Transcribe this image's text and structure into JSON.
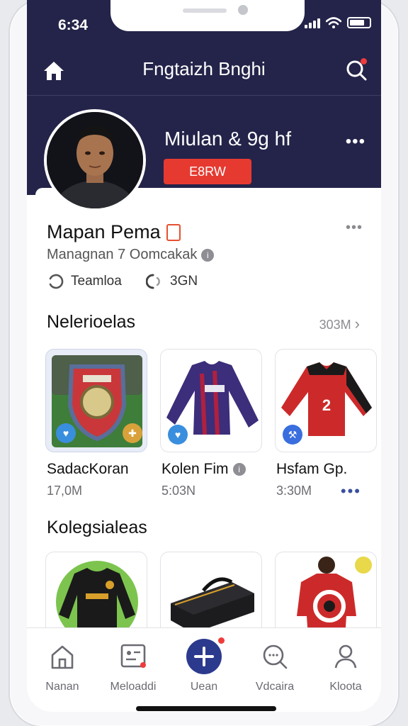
{
  "status_bar": {
    "time": "6:34"
  },
  "top_bar": {
    "title": "Fngtaizh Bnghi"
  },
  "hero": {
    "name": "Miulan & 9g hf",
    "badge": "E8RW",
    "more": "•••"
  },
  "profile": {
    "name": "Mapan Pema",
    "subtitle": "Managnan 7 Oomcakak",
    "more": "•••",
    "stats": [
      {
        "label": "Teamloa"
      },
      {
        "label": "3GN"
      }
    ]
  },
  "sections": [
    {
      "title": "Nelerioelas",
      "link": "303M",
      "items": [
        {
          "name": "SadacKoran",
          "size": "17,0M"
        },
        {
          "name": "Kolen Fim",
          "size": "5:03N"
        },
        {
          "name": "Hsfam Gp.",
          "size": "3:30M"
        }
      ],
      "more": "•••"
    },
    {
      "title": "Kolegsialeas"
    }
  ],
  "jersey_number": "2",
  "tab_bar": {
    "tabs": [
      {
        "label": "Nanan",
        "icon": "home-outline-icon"
      },
      {
        "label": "Meloaddi",
        "icon": "profile-card-icon"
      },
      {
        "label": "Uean",
        "icon": "add-icon"
      },
      {
        "label": "Vdcaira",
        "icon": "chat-search-icon"
      },
      {
        "label": "Kloota",
        "icon": "person-icon"
      }
    ]
  },
  "colors": {
    "header": "#24244a",
    "accent": "#e63a31",
    "primary": "#2c3a8e"
  }
}
